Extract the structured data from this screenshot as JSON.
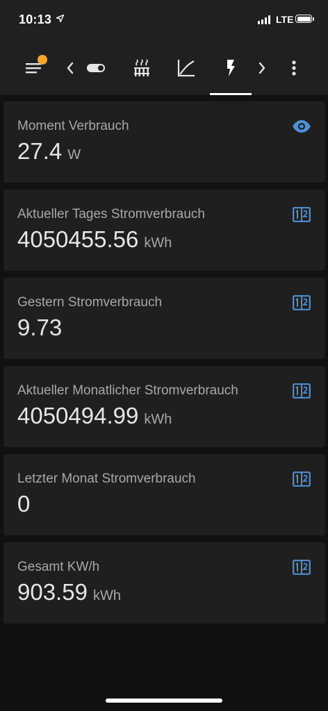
{
  "status_bar": {
    "time": "10:13",
    "network": "LTE"
  },
  "toolbar": {
    "icons": [
      "menu-icon",
      "chevron-left-icon",
      "toggle-switch-icon",
      "radiator-icon",
      "chart-line-icon",
      "flash-icon",
      "chevron-right-icon",
      "dots-vertical-icon"
    ],
    "active_tab": "flash",
    "badge_color": "#f4a531"
  },
  "colors": {
    "background": "#111111",
    "card": "#1f1f1f",
    "accent_icon": "#4f8fd6"
  },
  "cards": [
    {
      "label": "Moment Verbrauch",
      "value": "27.4",
      "unit": "W",
      "icon": "eye-icon"
    },
    {
      "label": "Aktueller Tages Stromverbrauch",
      "value": "4050455.56",
      "unit": "kWh",
      "icon": "counter-icon"
    },
    {
      "label": "Gestern Stromverbrauch",
      "value": "9.73",
      "unit": "",
      "icon": "counter-icon"
    },
    {
      "label": "Aktueller Monatlicher Stromverbrauch",
      "value": "4050494.99",
      "unit": "kWh",
      "icon": "counter-icon"
    },
    {
      "label": "Letzter Monat Stromverbrauch",
      "value": "0",
      "unit": "",
      "icon": "counter-icon"
    },
    {
      "label": "Gesamt KW/h",
      "value": "903.59",
      "unit": "kWh",
      "icon": "counter-icon"
    }
  ]
}
